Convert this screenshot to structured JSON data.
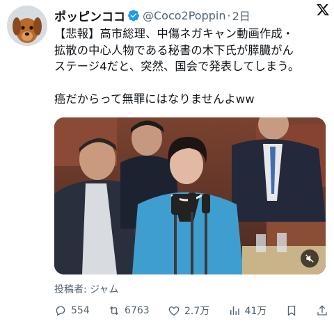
{
  "tweet": {
    "display_name": "ポッピンココ",
    "handle": "@Coco2Poppin",
    "separator": "·",
    "time": "2日",
    "text_lines": [
      "【悲報】高市総理、中傷ネガキャン動画作成・",
      "拡散の中心人物である秘書の木下氏が膵臓がん",
      "ステージ4だと、突然、国会で発表してしまう。",
      "",
      "癌だからって無罪にはなりませんよww"
    ],
    "attribution": "投稿者: ジャム"
  },
  "actions": {
    "replies": "554",
    "reposts": "6763",
    "likes": "2.7万",
    "views": "41万"
  },
  "icons": {
    "verified": "verified-badge-icon",
    "x_logo": "x-logo-icon",
    "mute": "mute-icon"
  },
  "colors": {
    "verified_blue": "#1d9bf0",
    "muted_text": "#536471",
    "primary_text": "#0f1419"
  }
}
